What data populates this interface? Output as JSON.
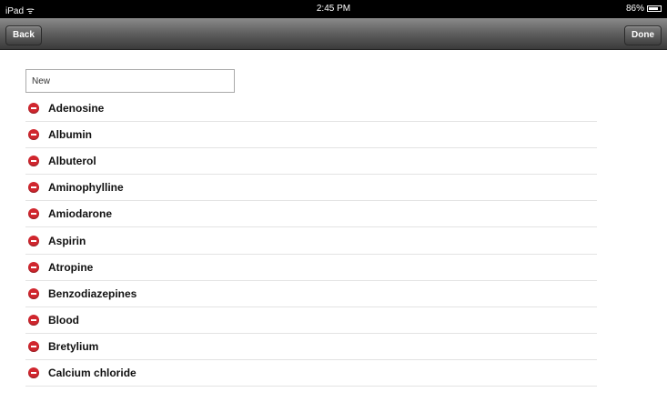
{
  "status_bar": {
    "carrier": "iPad ᯤ",
    "time": "2:45 PM",
    "battery": "86%"
  },
  "nav": {
    "back_label": "Back",
    "done_label": "Done"
  },
  "new_field": {
    "value": "New"
  },
  "items": [
    {
      "label": "Adenosine"
    },
    {
      "label": "Albumin"
    },
    {
      "label": "Albuterol"
    },
    {
      "label": "Aminophylline"
    },
    {
      "label": "Amiodarone"
    },
    {
      "label": "Aspirin"
    },
    {
      "label": "Atropine"
    },
    {
      "label": "Benzodiazepines"
    },
    {
      "label": "Blood"
    },
    {
      "label": "Bretylium"
    },
    {
      "label": "Calcium chloride"
    }
  ],
  "colors": {
    "delete": "#d0262e",
    "nav_bar": "#5e5e5e"
  },
  "icons": {
    "delete": "minus-circle-icon"
  }
}
